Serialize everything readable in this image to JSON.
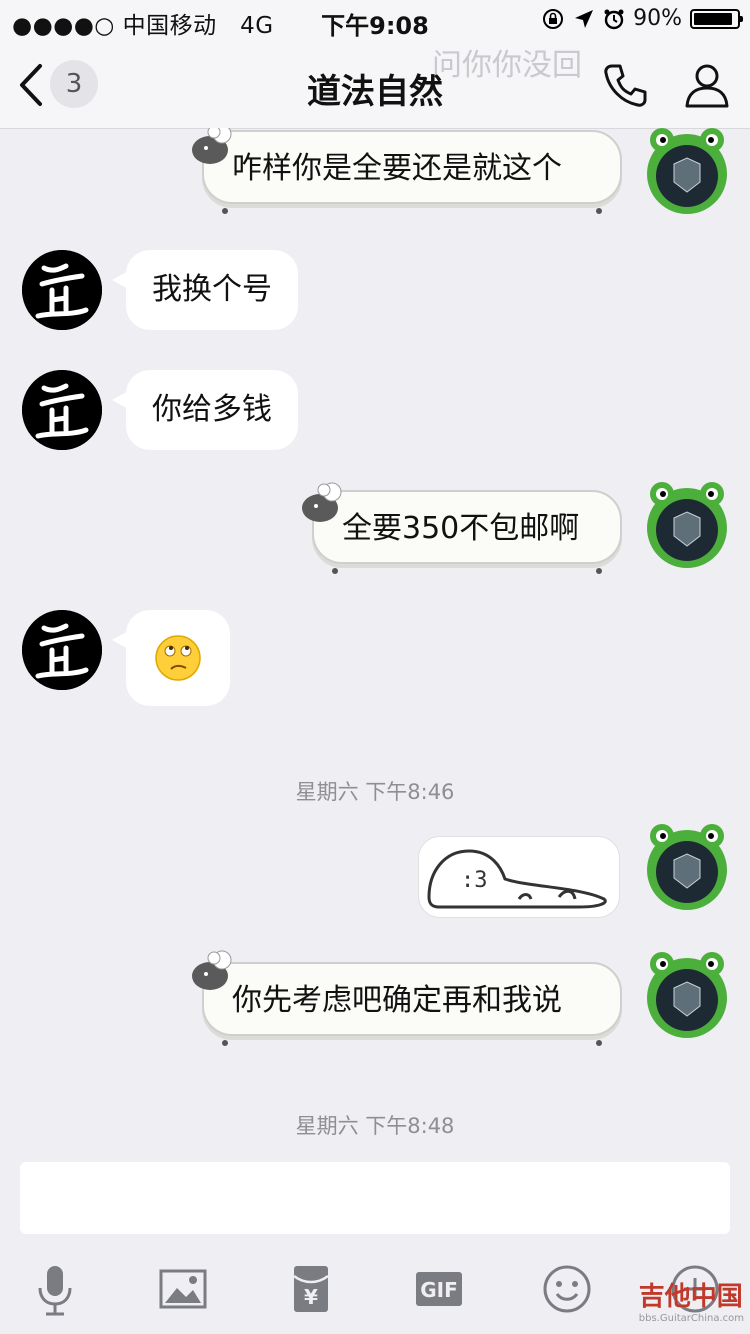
{
  "status_bar": {
    "carrier": "●●●●○ 中国移动",
    "network": "4G",
    "time": "下午9:08",
    "battery": "90%"
  },
  "nav": {
    "unread_count": "3",
    "title": "道法自然",
    "ghost_text": "问你你没回"
  },
  "messages": [
    {
      "side": "me",
      "text": "咋样你是全要还是就这个"
    },
    {
      "side": "them",
      "text": "我换个号"
    },
    {
      "side": "them",
      "text": "你给多钱"
    },
    {
      "side": "me",
      "text": "全要350不包邮啊"
    },
    {
      "side": "them",
      "type": "emoji",
      "icon": "eye-roll-emoji-icon"
    },
    {
      "side": "me",
      "type": "sticker",
      "text": ":3"
    },
    {
      "side": "me",
      "text": "你先考虑吧确定再和我说"
    }
  ],
  "timestamps": [
    "星期六 下午8:46",
    "星期六 下午8:48"
  ],
  "toolbar": {
    "icons": [
      "microphone-icon",
      "image-icon",
      "red-packet-icon",
      "gif-icon",
      "emoji-icon",
      "plus-icon"
    ],
    "gif_label": "GIF",
    "red_packet_label": "¥"
  },
  "watermark": {
    "brand": "吉他中国",
    "url": "bbs.GuitarChina.com"
  },
  "colors": {
    "background": "#eeeef3",
    "frog_green": "#4caf3c",
    "watermark_red": "#c0392b"
  }
}
